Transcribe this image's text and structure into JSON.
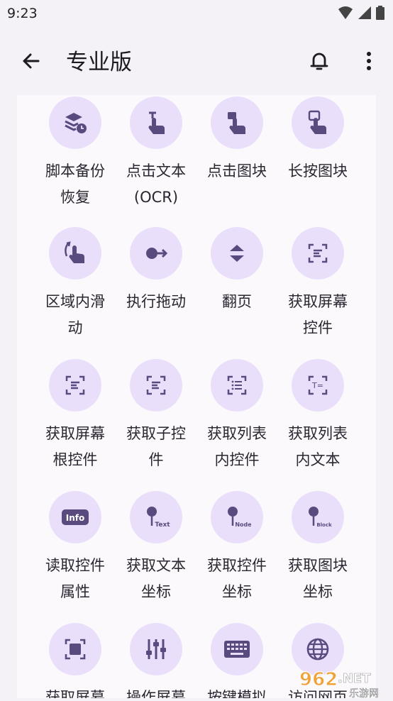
{
  "status": {
    "time": "9:23"
  },
  "header": {
    "title": "专业版"
  },
  "items": [
    {
      "label": "脚本备份\n恢复",
      "icon": "backup-clock-icon"
    },
    {
      "label": "点击文本\n(OCR)",
      "icon": "tap-text-icon"
    },
    {
      "label": "点击图块",
      "icon": "tap-block-icon"
    },
    {
      "label": "长按图块",
      "icon": "long-press-icon"
    },
    {
      "label": "区域内滑\n动",
      "icon": "swipe-area-icon"
    },
    {
      "label": "执行拖动",
      "icon": "drag-icon"
    },
    {
      "label": "翻页",
      "icon": "page-turn-icon"
    },
    {
      "label": "获取屏幕\n控件",
      "icon": "screen-control-icon"
    },
    {
      "label": "获取屏幕\n根控件",
      "icon": "root-control-icon"
    },
    {
      "label": "获取子控\n件",
      "icon": "child-control-icon"
    },
    {
      "label": "获取列表\n内控件",
      "icon": "list-control-icon"
    },
    {
      "label": "获取列表\n内文本",
      "icon": "list-text-icon"
    },
    {
      "label": "读取控件\n属性",
      "icon": "info-icon"
    },
    {
      "label": "获取文本\n坐标",
      "icon": "text-pin-icon"
    },
    {
      "label": "获取控件\n坐标",
      "icon": "node-pin-icon"
    },
    {
      "label": "获取图块\n坐标",
      "icon": "block-pin-icon"
    },
    {
      "label": "获取屏幕",
      "icon": "screenshot-icon"
    },
    {
      "label": "操作屏幕",
      "icon": "sliders-icon"
    },
    {
      "label": "按键模拟",
      "icon": "keyboard-icon"
    },
    {
      "label": "访问网页",
      "icon": "globe-icon"
    }
  ],
  "icon_text": {
    "info": "Info",
    "text_pin": "Text",
    "node_pin": "Node",
    "block_pin": "Block",
    "t_eq": "T="
  },
  "watermark": {
    "text_962": "962",
    "text_net": ".NET",
    "text_site": "乐游网"
  },
  "colors": {
    "accent": "#5b4a7e",
    "icon_bg": "#e9dffb",
    "surface": "#fbf9fc",
    "appbar": "#f4f1f7"
  }
}
